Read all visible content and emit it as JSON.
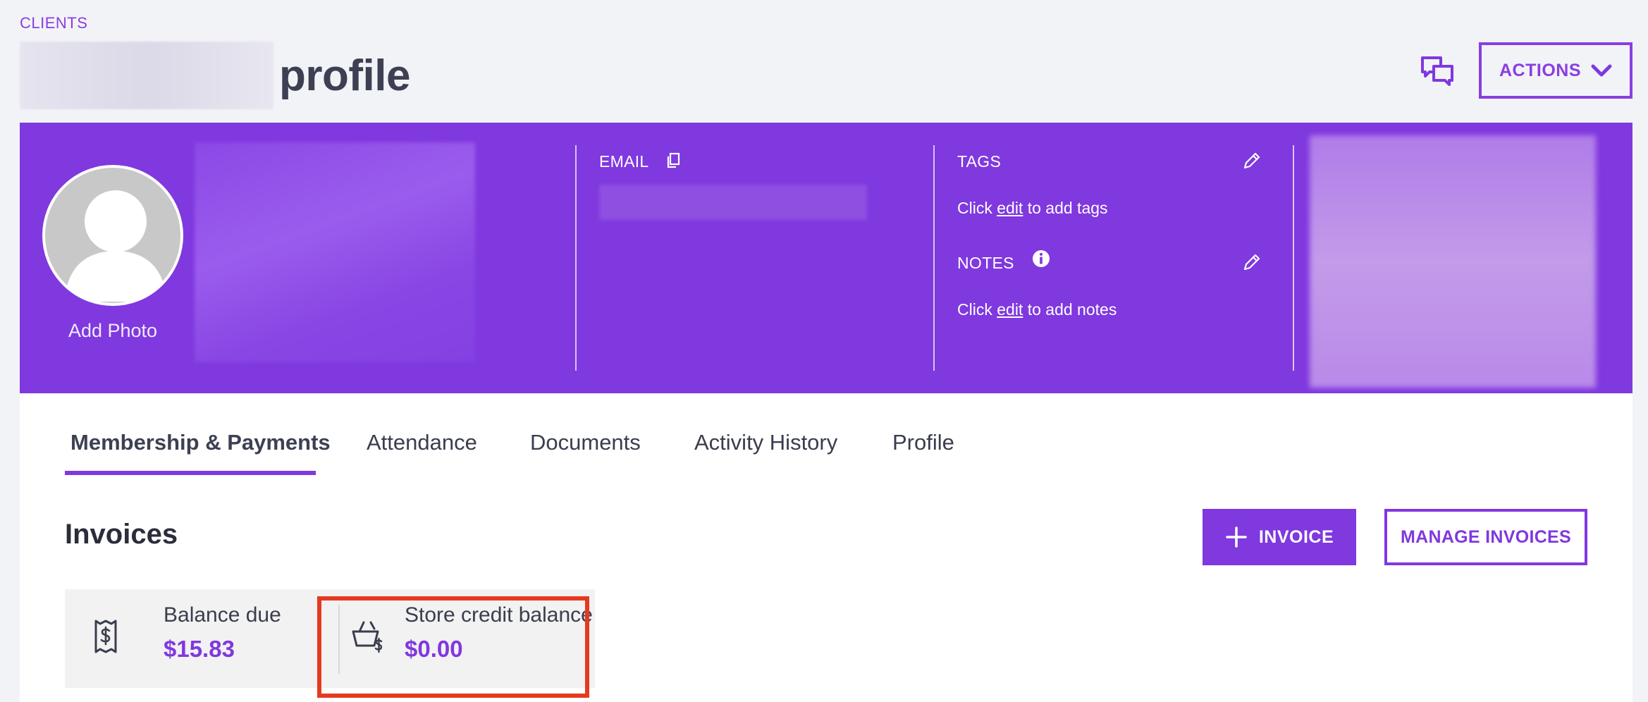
{
  "header": {
    "breadcrumb": "CLIENTS",
    "title_suffix": "profile",
    "actions_label": "ACTIONS"
  },
  "banner": {
    "add_photo": "Add Photo",
    "email_label": "EMAIL",
    "tags_label": "TAGS",
    "tags_prefix": "Click",
    "tags_link": "edit",
    "tags_suffix": "to add tags",
    "notes_label": "NOTES",
    "notes_prefix": "Click",
    "notes_link": "edit",
    "notes_suffix": "to add notes"
  },
  "tabs": [
    {
      "label": "Membership & Payments",
      "active": true
    },
    {
      "label": "Attendance"
    },
    {
      "label": "Documents"
    },
    {
      "label": "Activity History"
    },
    {
      "label": "Profile"
    }
  ],
  "invoices": {
    "title": "Invoices",
    "add_label": "INVOICE",
    "manage_label": "MANAGE INVOICES",
    "balance_due_label": "Balance due",
    "balance_due_value": "$15.83",
    "store_credit_label": "Store credit balance",
    "store_credit_value": "$0.00"
  },
  "colors": {
    "accent": "#8038df",
    "highlight": "#e53a20"
  },
  "icons": {
    "chat": "chat-bubbles-icon",
    "copy": "copy-icon",
    "edit": "pencil-icon",
    "info": "info-icon",
    "receipt": "receipt-dollar-icon",
    "basket": "basket-dollar-icon",
    "plus": "plus-icon",
    "chevron": "chevron-down-icon"
  }
}
